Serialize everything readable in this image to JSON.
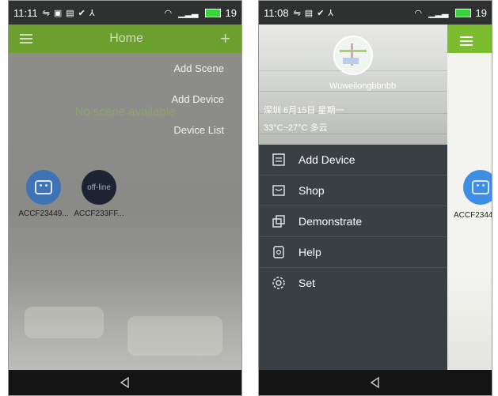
{
  "left_screen": {
    "status": {
      "time": "11:11",
      "battery_level": "19"
    },
    "header": {
      "title": "Home",
      "menu_icon": "hamburger-icon",
      "add_icon": "plus-icon"
    },
    "empty_state": "No scene available",
    "dropdown": [
      "Add Scene",
      "Add Device",
      "Device List"
    ],
    "devices": [
      {
        "label": "ACCF23449...",
        "state_text": "",
        "color": "#3e74b5"
      },
      {
        "label": "ACCF233FF...",
        "state_text": "off-line",
        "color": "#1c2433"
      }
    ]
  },
  "right_screen": {
    "status": {
      "time": "11:08",
      "battery_level": "19"
    },
    "profile": {
      "username": "Wuweilongbbnbb",
      "date_line": "深圳  6月15日  星期一",
      "weather_line": "33°C~27°C  多云"
    },
    "drawer_items": [
      {
        "label": "Add Device",
        "icon": "add-device-icon"
      },
      {
        "label": "Shop",
        "icon": "shop-icon"
      },
      {
        "label": "Demonstrate",
        "icon": "demonstrate-icon"
      },
      {
        "label": "Help",
        "icon": "help-icon"
      },
      {
        "label": "Set",
        "icon": "settings-gear-icon"
      }
    ],
    "peek": {
      "device_label": "ACCF2344"
    }
  },
  "colors": {
    "header_green": "#6b9f2e",
    "peek_green": "#7bbd2f",
    "drawer_bg": "#3a3f44",
    "device_blue": "#3f8ee6"
  }
}
